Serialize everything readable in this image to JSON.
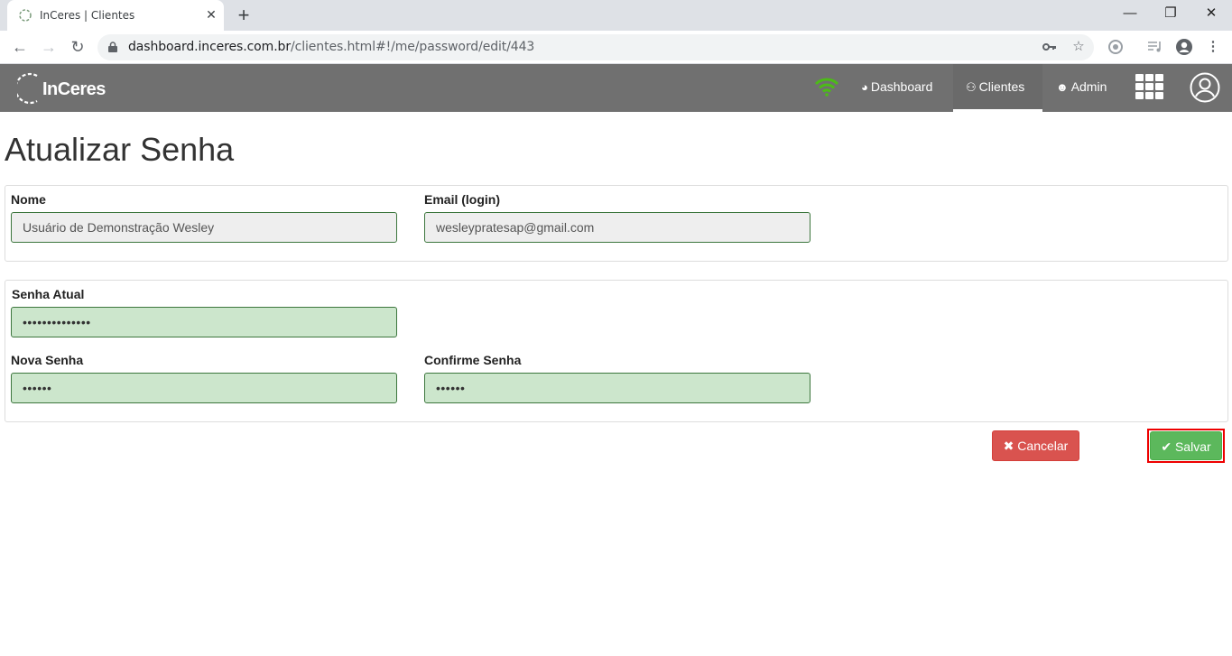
{
  "browser": {
    "tab_title": "InCeres | Clientes",
    "tab_close": "✕",
    "new_tab": "+",
    "url_host": "dashboard.inceres.com.br",
    "url_path": "/clientes.html#!/me/password/edit/443",
    "window_controls": {
      "minimize": "—",
      "maximize": "❐",
      "close": "✕"
    }
  },
  "navbar": {
    "logo_text": "InCeres",
    "items": [
      {
        "label": "Dashboard",
        "icon": "dashboard-icon",
        "active": false
      },
      {
        "label": "Clientes",
        "icon": "users-icon",
        "active": true
      },
      {
        "label": "Admin",
        "icon": "user-plus-icon",
        "active": false
      }
    ],
    "wifi_color": "#4cbb17"
  },
  "page": {
    "title": "Atualizar Senha",
    "profile": {
      "name_label": "Nome",
      "name_value": "Usuário de Demonstração Wesley",
      "email_label": "Email (login)",
      "email_value": "wesleypratesap@gmail.com"
    },
    "password": {
      "current_label": "Senha Atual",
      "current_value": "••••••••••••••",
      "new_label": "Nova Senha",
      "new_value": "••••••",
      "confirm_label": "Confirme Senha",
      "confirm_value": "••••••"
    },
    "actions": {
      "cancel_label": "Cancelar",
      "save_label": "Salvar"
    }
  },
  "colors": {
    "navbar": "#707070",
    "cancel": "#d9534f",
    "save": "#5cb85c",
    "field_valid_bg": "#cce6cc",
    "highlight": "#ee0000"
  }
}
